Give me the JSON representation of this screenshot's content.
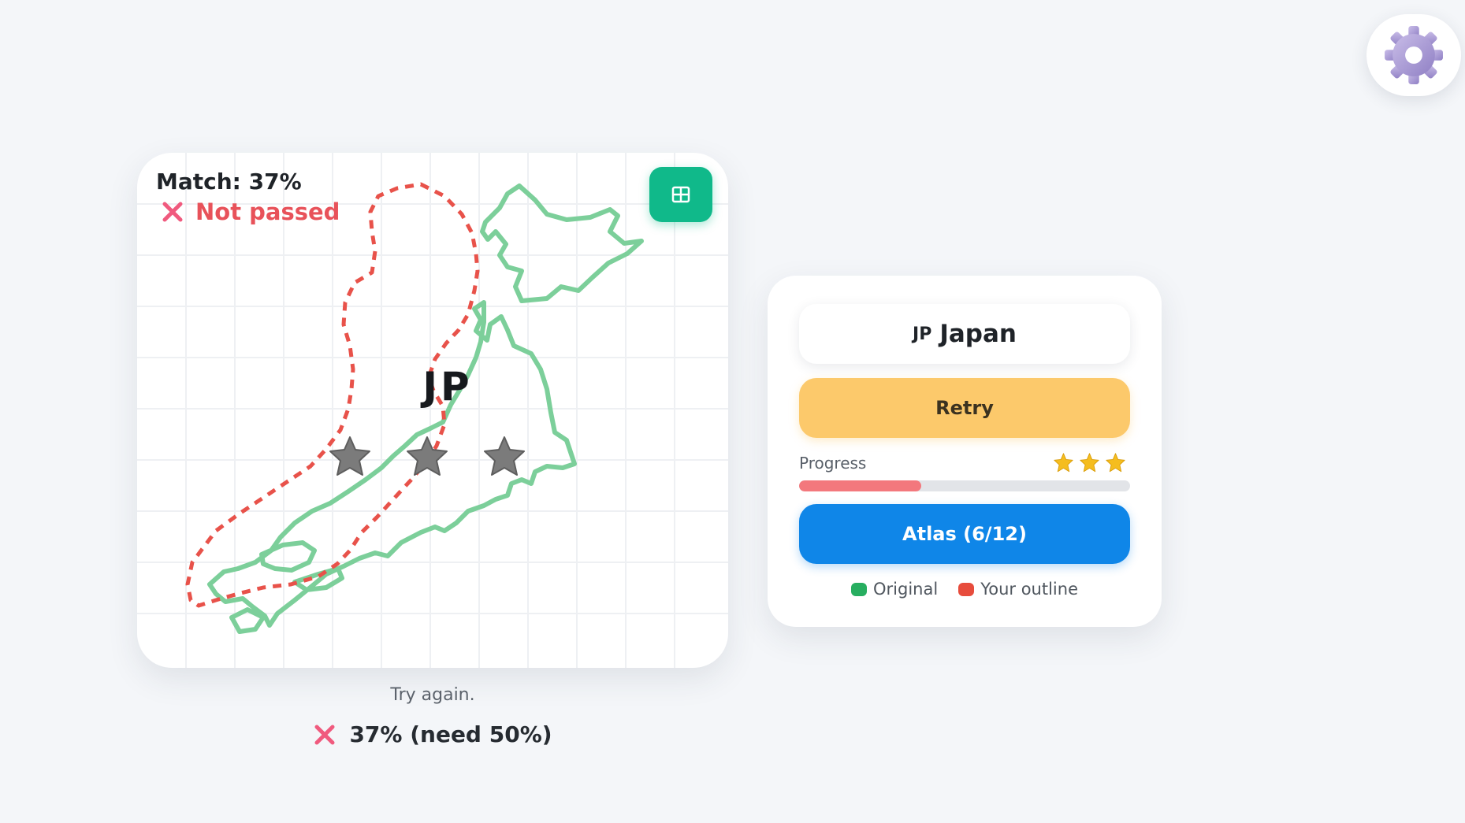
{
  "settings": {
    "icon": "gear-icon"
  },
  "map_card": {
    "match_label": "Match: 37%",
    "status_label": "Not passed",
    "status_icon": "x-icon",
    "country_code": "JP",
    "grid_button_icon": "grid-icon",
    "stars_earned": 0,
    "stars_total": 3,
    "original_color": "#7ccf9a",
    "outline_color": "#e8524a"
  },
  "feedback": {
    "message": "Try again.",
    "result_text": "37% (need 50%)"
  },
  "panel": {
    "country_code": "JP",
    "country_name": "Japan",
    "retry_label": "Retry",
    "progress_label": "Progress",
    "progress_fraction": 0.37,
    "progress_stars": 3,
    "atlas_label": "Atlas (6/12)",
    "legend": [
      {
        "label": "Original",
        "color": "#27ae60"
      },
      {
        "label": "Your outline",
        "color": "#e74c3c"
      }
    ]
  },
  "colors": {
    "accent_green": "#10b98a",
    "retry_yellow": "#fcc96b",
    "atlas_blue": "#0f86e8",
    "fail_red": "#e8525a",
    "progress_fill": "#f3787d",
    "star_gold": "#f5bd1f",
    "star_gray": "#7b7b7b"
  }
}
